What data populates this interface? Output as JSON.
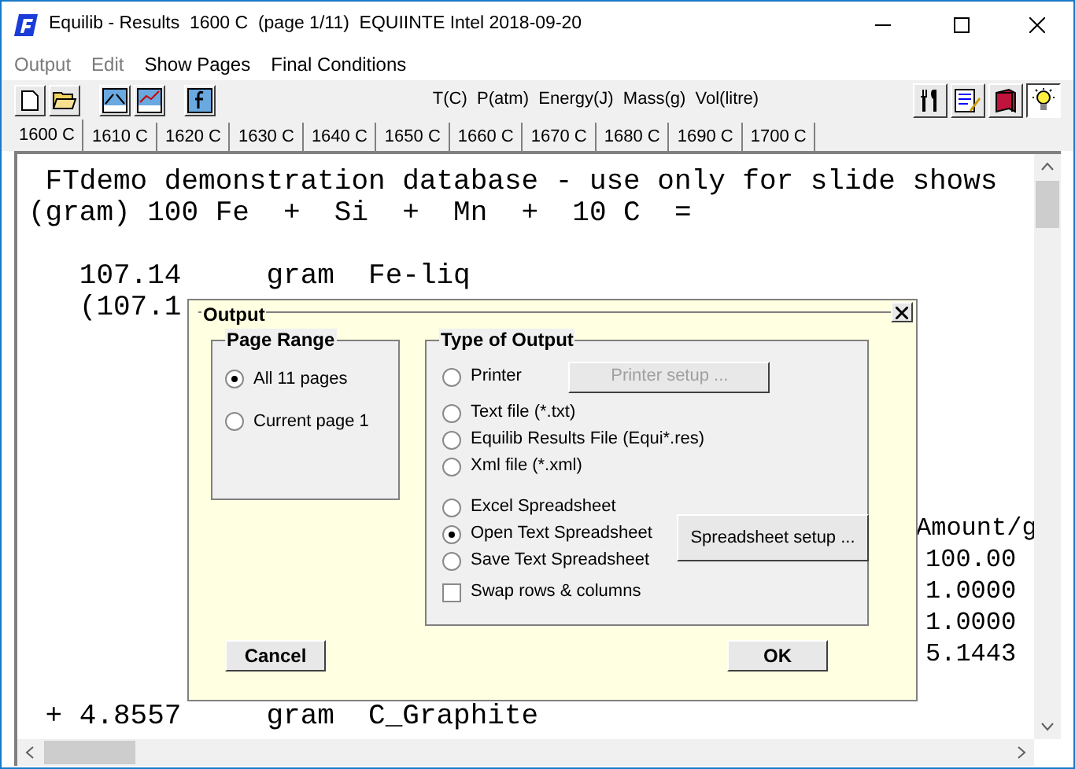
{
  "window": {
    "title": "Equilib - Results  1600 C  (page 1/11)  EQUIINTE Intel 2018-09-20"
  },
  "menu": [
    {
      "label": "Output",
      "disabled": true
    },
    {
      "label": "Edit",
      "disabled": true
    },
    {
      "label": "Show Pages",
      "disabled": false
    },
    {
      "label": "Final Conditions",
      "disabled": false
    }
  ],
  "toolbar": {
    "units": "T(C)  P(atm)  Energy(J)  Mass(g)  Vol(litre)",
    "right_tools": [
      {
        "kind": "cutlery",
        "selected": false
      },
      {
        "kind": "edit",
        "selected": false
      },
      {
        "kind": "book",
        "selected": false
      },
      {
        "kind": "bulb",
        "selected": true
      }
    ]
  },
  "tabs": [
    {
      "label": "1600 C",
      "selected": true
    },
    {
      "label": "1610 C",
      "selected": false
    },
    {
      "label": "1620 C",
      "selected": false
    },
    {
      "label": "1630 C",
      "selected": false
    },
    {
      "label": "1640 C",
      "selected": false
    },
    {
      "label": "1650 C",
      "selected": false
    },
    {
      "label": "1660 C",
      "selected": false
    },
    {
      "label": "1670 C",
      "selected": false
    },
    {
      "label": "1680 C",
      "selected": false
    },
    {
      "label": "1690 C",
      "selected": false
    },
    {
      "label": "1700 C",
      "selected": false
    }
  ],
  "results": {
    "header_lines": [
      " FTdemo demonstration database - use only for slide shows",
      "(gram) 100 Fe  +  Si  +  Mn  +  10 C  ="
    ],
    "phase_lines": [
      "   107.14     gram  Fe-liq",
      "   (107.1"
    ],
    "amount_column": [
      {
        "kind": "heading",
        "text": "Amount/g"
      },
      {
        "kind": "value",
        "text": "100.00"
      },
      {
        "kind": "value",
        "text": "1.0000"
      },
      {
        "kind": "value",
        "text": "1.0000"
      },
      {
        "kind": "value",
        "text": "5.1443"
      }
    ],
    "final_line": " + 4.8557     gram  C_Graphite"
  },
  "dialog": {
    "title": "Output",
    "page_range": {
      "title": "Page Range",
      "options": [
        {
          "label": "All 11 pages",
          "selected": true
        },
        {
          "label": "Current page 1",
          "selected": false
        }
      ]
    },
    "type_of_output": {
      "title": "Type of Output",
      "options": [
        {
          "label": "Printer",
          "selected": false
        },
        {
          "label": "Text file  (*.txt)",
          "selected": false
        },
        {
          "label": "Equilib Results File  (Equi*.res)",
          "selected": false
        },
        {
          "label": "Xml file  (*.xml)",
          "selected": false
        },
        {
          "label": "Excel Spreadsheet",
          "selected": false
        },
        {
          "label": "Open Text Spreadsheet",
          "selected": true
        },
        {
          "label": "Save Text Spreadsheet",
          "selected": false
        }
      ],
      "printer_setup": {
        "label": "Printer setup ...",
        "disabled": true
      },
      "spreadsheet_setup": {
        "label": "Spreadsheet setup ...",
        "disabled": false
      },
      "swap": {
        "label": "Swap rows & columns",
        "checked": false
      }
    },
    "buttons": [
      "Cancel",
      "OK"
    ]
  }
}
